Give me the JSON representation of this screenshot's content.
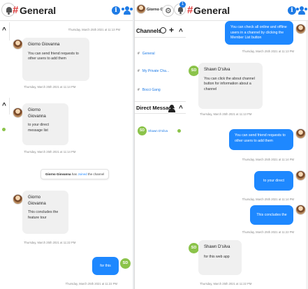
{
  "channel": {
    "hash": "#",
    "name": "General"
  },
  "workspace": {
    "name": "Giorno Gio..."
  },
  "colors": {
    "accent": "#1e88ff",
    "hash": "#e03b3b",
    "online": "#8bc34a"
  },
  "icons": [
    "bell-icon",
    "info-icon",
    "users-icon",
    "chevron-up-icon",
    "settings-icon",
    "add-icon",
    "compass-icon",
    "add-user-icon"
  ],
  "notifications": {
    "count": "1"
  },
  "sidebar": {
    "channels_header": "Channels",
    "channels": [
      {
        "hash": "#",
        "label": "General"
      },
      {
        "hash": "#",
        "label": "My Private Cha..."
      },
      {
        "hash": "#",
        "label": "Bocci Gang"
      }
    ],
    "dm_header": "Direct Message",
    "dms": [
      {
        "initials": "SD",
        "label": "Shawn D'silva"
      }
    ]
  },
  "panel1": {
    "messages": [
      {
        "ts": "Thursday, March 25th 2021 at 11:13 PM"
      },
      {
        "sender": "Giorno Giovanna",
        "text": "You can send friend requests to other users to add them",
        "ts": "Thursday, March 25th 2021 at 11:14 PM"
      },
      {
        "sender": "Giorno Giovanna",
        "text": "to your direct message list",
        "ts": "Thursday, March 25th 2021 at 11:14 PM"
      },
      {
        "system_name": "Giorno Giovanna",
        "system_has": "has",
        "system_joined": "Joined",
        "system_rest": "the channel"
      },
      {
        "sender": "Giorno Giovanna",
        "text": "This concludes the feature tour",
        "ts": "Thursday, March 25th 2021 at 11:22 PM"
      },
      {
        "text": "for this web app",
        "ts": "Thursday, March 25th 2021 at 11:22 PM",
        "initials": "SD"
      }
    ]
  },
  "panel3": {
    "messages": [
      {
        "text": "You can check all online and offline users in a channel by clicking the Member List button",
        "ts": "Thursday, March 25th 2021 at 11:13 PM"
      },
      {
        "sender": "Shawn D'silva",
        "initials": "SD",
        "text": "You can click the about channel button for information about a channel",
        "ts": "Thursday, March 25th 2021 at 11:13 PM"
      },
      {
        "text": "You can send friend requests to other users to add them",
        "ts": "Thursday, March 25th 2021 at 11:14 PM"
      },
      {
        "text": "to your direct message list",
        "ts": "Thursday, March 25th 2021 at 11:14 PM"
      },
      {
        "text": "This concludes the feature tour",
        "ts": "Thursday, March 25th 2021 at 11:22 PM"
      },
      {
        "sender": "Shawn D'silva",
        "initials": "SD",
        "text": "for this web app",
        "ts": "Thursday, March 25th 2021 at 11:22 PM"
      }
    ]
  }
}
